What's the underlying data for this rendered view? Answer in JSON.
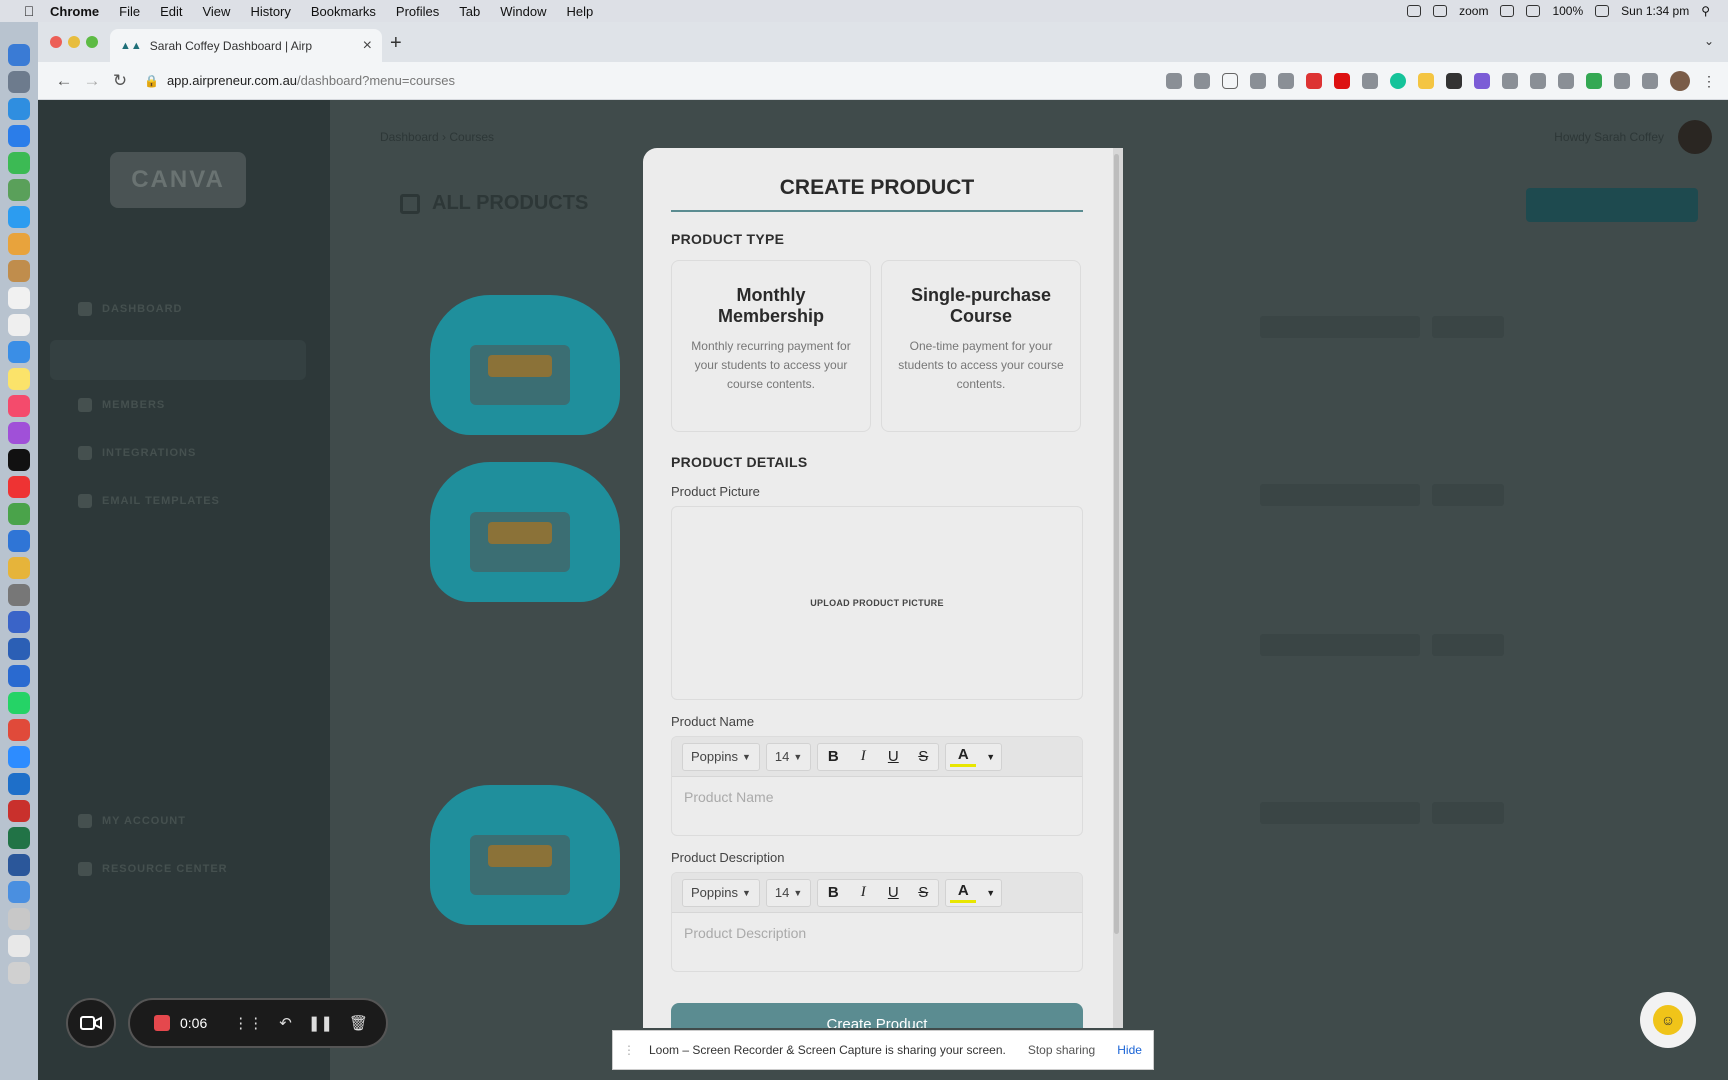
{
  "menubar": {
    "apple": "",
    "items": [
      "Chrome",
      "File",
      "Edit",
      "View",
      "History",
      "Bookmarks",
      "Profiles",
      "Tab",
      "Window",
      "Help"
    ],
    "zoom": "zoom",
    "battery": "100%",
    "clock": "Sun 1:34 pm"
  },
  "browser": {
    "tab_title": "Sarah Coffey Dashboard | Airp",
    "url_host": "app.airpreneur.com.au",
    "url_path": "/dashboard?menu=courses"
  },
  "app": {
    "crumb": "Dashboard  ›  Courses",
    "all_products": "ALL PRODUCTS",
    "hello": "Howdy Sarah Coffey",
    "logo": "CANVA",
    "sidebar": [
      "DASHBOARD",
      "MEMBERS",
      "INTEGRATIONS",
      "EMAIL TEMPLATES",
      "MY ACCOUNT",
      "RESOURCE CENTER"
    ]
  },
  "modal": {
    "title": "CREATE PRODUCT",
    "product_type_label": "PRODUCT TYPE",
    "cards": [
      {
        "title": "Monthly Membership",
        "desc": "Monthly recurring payment for your students to access your course contents."
      },
      {
        "title": "Single-purchase Course",
        "desc": "One-time payment for your students to access your course contents."
      }
    ],
    "product_details_label": "PRODUCT DETAILS",
    "picture_label": "Product Picture",
    "upload_label": "UPLOAD PRODUCT PICTURE",
    "name_label": "Product Name",
    "name_placeholder": "Product Name",
    "desc_label": "Product Description",
    "desc_placeholder": "Product Description",
    "font": "Poppins",
    "size": "14",
    "bold": "B",
    "italic": "I",
    "underline": "U",
    "strike": "S",
    "color": "A",
    "submit": "Create Product"
  },
  "loom": {
    "timer": "0:06",
    "share_text": "Loom – Screen Recorder & Screen Capture is sharing your screen.",
    "stop": "Stop sharing",
    "hide": "Hide"
  },
  "colors": {
    "accent": "#5b8c91",
    "overlay_dark": "#3d4848"
  }
}
